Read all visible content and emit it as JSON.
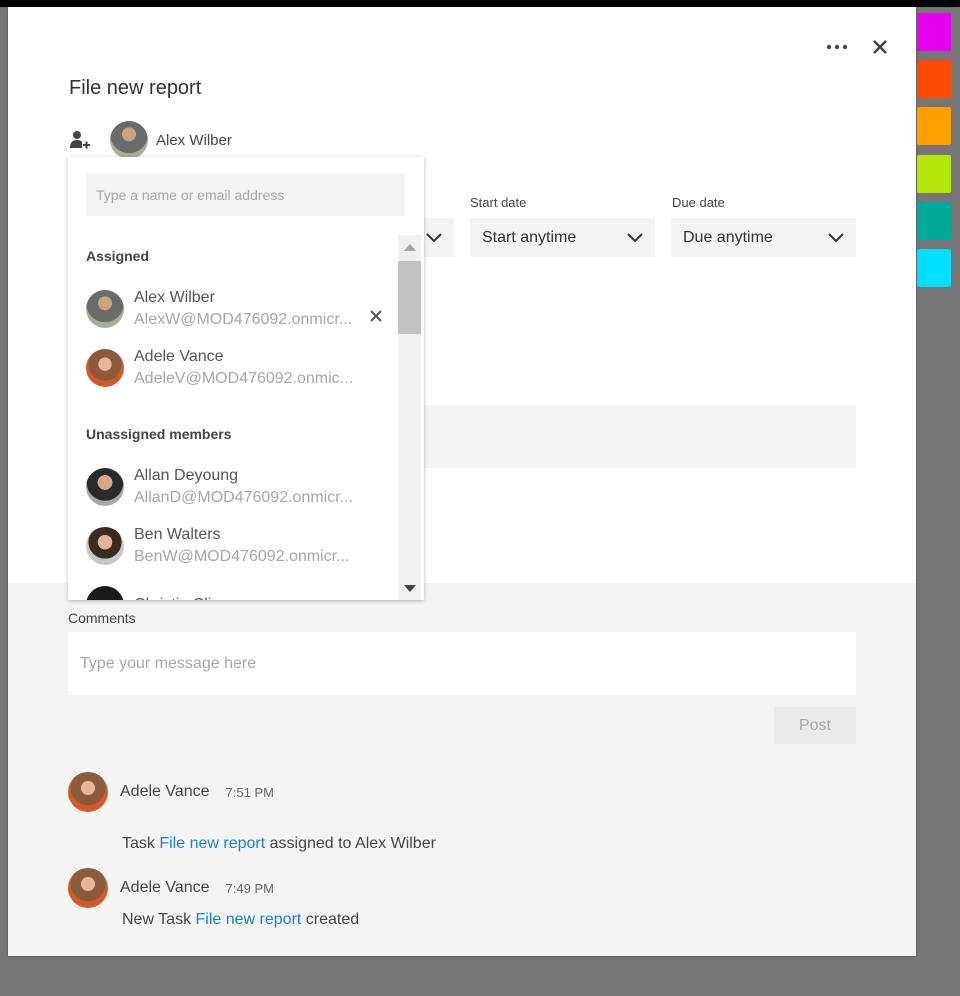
{
  "dialog": {
    "title": "File new report",
    "more_label": "•••",
    "close_label": "✕",
    "assignee": {
      "name": "Alex Wilber"
    }
  },
  "swatches": [
    "#e600ef",
    "#ff4a00",
    "#ffa000",
    "#b5e60a",
    "#00a99a",
    "#00dfff"
  ],
  "fields": {
    "start_date": {
      "label": "Start date",
      "value": "Start anytime"
    },
    "due_date": {
      "label": "Due date",
      "value": "Due anytime"
    }
  },
  "picker": {
    "search_placeholder": "Type a name or email address",
    "assigned_header": "Assigned",
    "unassigned_header": "Unassigned members",
    "assigned": [
      {
        "name": "Alex Wilber",
        "email": "AlexW@MOD476092.onmicr..."
      },
      {
        "name": "Adele Vance",
        "email": "AdeleV@MOD476092.onmic..."
      }
    ],
    "unassigned": [
      {
        "name": "Allan Deyoung",
        "email": "AllanD@MOD476092.onmicr..."
      },
      {
        "name": "Ben Walters",
        "email": "BenW@MOD476092.onmicr..."
      },
      {
        "name": "Christie Cline",
        "email": ""
      }
    ],
    "remove_label": "✕"
  },
  "comments": {
    "label": "Comments",
    "placeholder": "Type your message here",
    "post_label": "Post"
  },
  "activity": [
    {
      "author": "Adele Vance",
      "time": "7:51 PM",
      "prefix": "Task ",
      "link": "File new report",
      "suffix": " assigned to Alex Wilber"
    },
    {
      "author": "Adele Vance",
      "time": "7:49 PM",
      "prefix": "New Task ",
      "link": "File new report",
      "suffix": " created"
    }
  ]
}
